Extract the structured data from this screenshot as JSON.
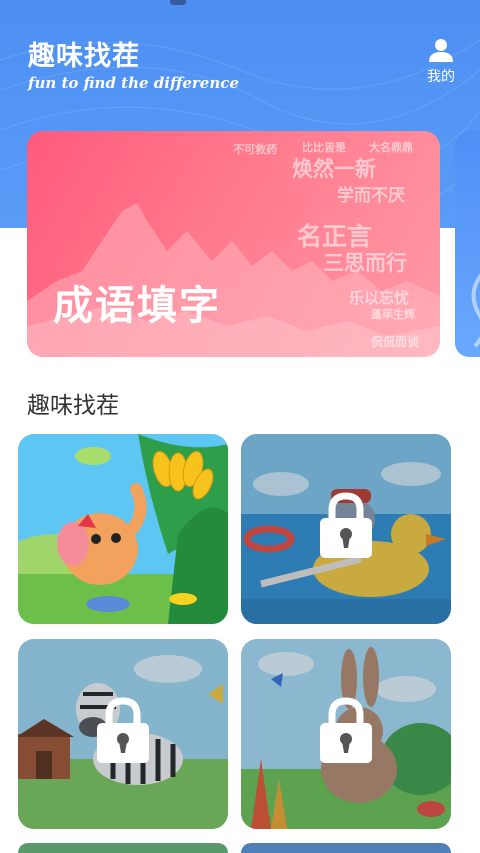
{
  "header": {
    "title": "趣味找茬",
    "subtitle": "fun to find the difference",
    "profile_label": "我的",
    "profile_icon": "user-icon"
  },
  "banner": {
    "title": "成语填字",
    "idioms": [
      "不可救药",
      "比比皆是",
      "大名鼎鼎",
      "焕然一新",
      "学而不厌",
      "名正言",
      "三思而行",
      "乐以忘忧",
      "蓬荜生辉",
      "侃侃而谈"
    ]
  },
  "section": {
    "title": "趣味找茬"
  },
  "puzzles": [
    {
      "scene": "elephant",
      "locked": false,
      "lock_icon": ""
    },
    {
      "scene": "hippo-duck",
      "locked": true,
      "lock_icon": "lock-icon"
    },
    {
      "scene": "zebra",
      "locked": true,
      "lock_icon": "lock-icon"
    },
    {
      "scene": "rabbit",
      "locked": true,
      "lock_icon": "lock-icon"
    }
  ],
  "colors": {
    "header_blue": "#4d8ff2",
    "banner_pink": "#ff5b7a",
    "text_dark": "#333333"
  }
}
